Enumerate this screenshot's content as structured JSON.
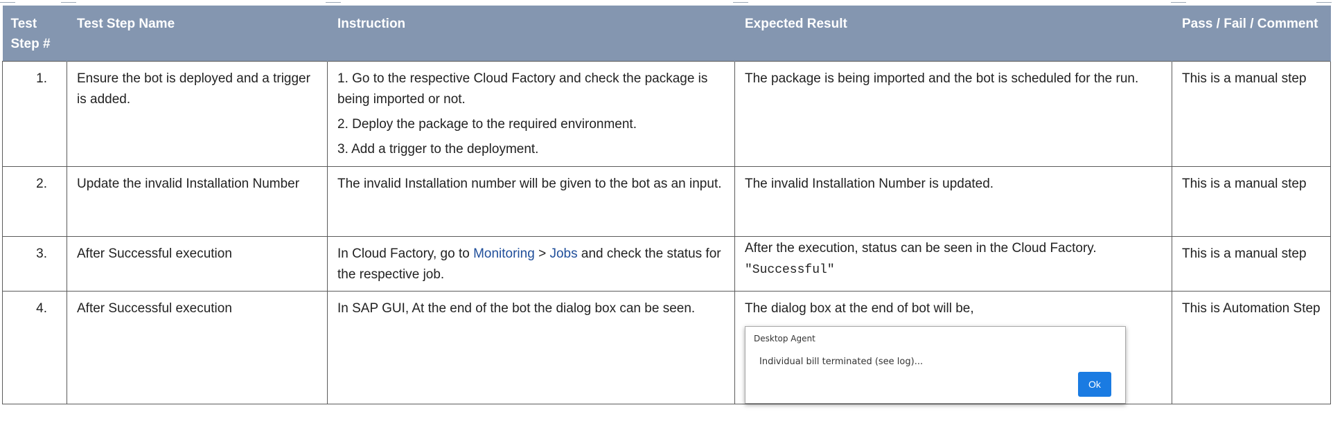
{
  "table": {
    "headers": [
      "Test Step #",
      "Test Step Name",
      "Instruction",
      "Expected Result",
      "Pass / Fail / Comment"
    ],
    "rows": [
      {
        "num": "1.",
        "name": "Ensure the bot is deployed and a trigger is added.",
        "instructions": [
          "1. Go to the respective Cloud Factory and check the package is being imported or not.",
          "2. Deploy the package to the required environment.",
          "3. Add a trigger to the deployment."
        ],
        "expected": "The package is being imported and the bot is scheduled for the run.",
        "comment": "This is a manual step"
      },
      {
        "num": "2.",
        "name": "Update the invalid Installation Number",
        "instruction": "The invalid Installation number will be given to the bot as an input.",
        "expected": "The invalid Installation Number is updated.",
        "comment": "This is a manual step"
      },
      {
        "num": "3.",
        "name": "After Successful execution",
        "instruction_prefix": "In Cloud Factory, go to ",
        "link_monitoring": "Monitoring",
        "sep": " > ",
        "link_jobs": "Jobs",
        "instruction_suffix": " and check the status for the respective job.",
        "expected": "After the execution, status can be seen in the Cloud Factory.",
        "expected_status": "\"Successful\"",
        "comment": "This is a manual step"
      },
      {
        "num": "4.",
        "name": "After Successful execution",
        "instruction": "In SAP GUI, At the end of the bot the dialog box can be seen.",
        "expected": "The dialog box at the end of bot will be,",
        "dialog": {
          "title": "Desktop Agent",
          "message": "Individual bill terminated (see log)...",
          "ok": "Ok"
        },
        "comment": "This is Automation Step"
      }
    ]
  }
}
